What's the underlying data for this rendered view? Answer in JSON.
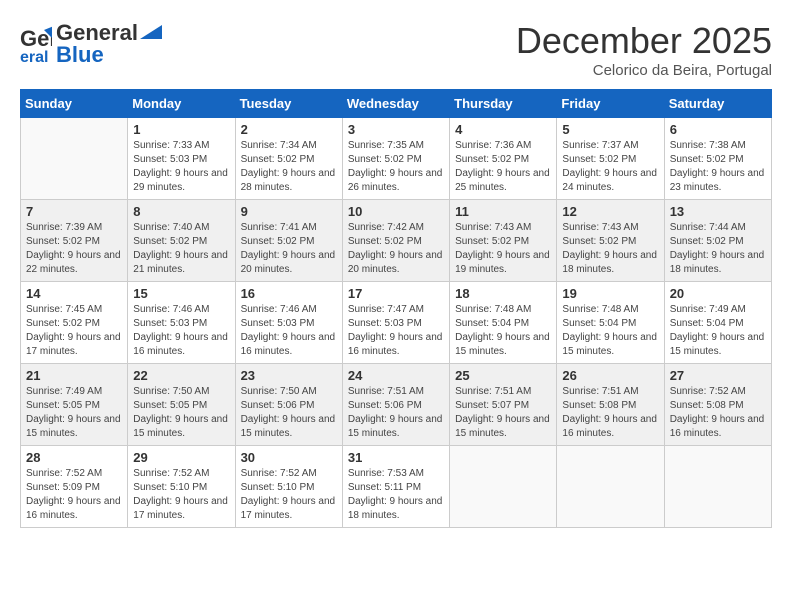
{
  "header": {
    "logo_general": "General",
    "logo_blue": "Blue",
    "month_title": "December 2025",
    "location": "Celorico da Beira, Portugal"
  },
  "weekdays": [
    "Sunday",
    "Monday",
    "Tuesday",
    "Wednesday",
    "Thursday",
    "Friday",
    "Saturday"
  ],
  "weeks": [
    [
      {
        "day": "",
        "sunrise": "",
        "sunset": "",
        "daylight": ""
      },
      {
        "day": "1",
        "sunrise": "Sunrise: 7:33 AM",
        "sunset": "Sunset: 5:03 PM",
        "daylight": "Daylight: 9 hours and 29 minutes."
      },
      {
        "day": "2",
        "sunrise": "Sunrise: 7:34 AM",
        "sunset": "Sunset: 5:02 PM",
        "daylight": "Daylight: 9 hours and 28 minutes."
      },
      {
        "day": "3",
        "sunrise": "Sunrise: 7:35 AM",
        "sunset": "Sunset: 5:02 PM",
        "daylight": "Daylight: 9 hours and 26 minutes."
      },
      {
        "day": "4",
        "sunrise": "Sunrise: 7:36 AM",
        "sunset": "Sunset: 5:02 PM",
        "daylight": "Daylight: 9 hours and 25 minutes."
      },
      {
        "day": "5",
        "sunrise": "Sunrise: 7:37 AM",
        "sunset": "Sunset: 5:02 PM",
        "daylight": "Daylight: 9 hours and 24 minutes."
      },
      {
        "day": "6",
        "sunrise": "Sunrise: 7:38 AM",
        "sunset": "Sunset: 5:02 PM",
        "daylight": "Daylight: 9 hours and 23 minutes."
      }
    ],
    [
      {
        "day": "7",
        "sunrise": "Sunrise: 7:39 AM",
        "sunset": "Sunset: 5:02 PM",
        "daylight": "Daylight: 9 hours and 22 minutes."
      },
      {
        "day": "8",
        "sunrise": "Sunrise: 7:40 AM",
        "sunset": "Sunset: 5:02 PM",
        "daylight": "Daylight: 9 hours and 21 minutes."
      },
      {
        "day": "9",
        "sunrise": "Sunrise: 7:41 AM",
        "sunset": "Sunset: 5:02 PM",
        "daylight": "Daylight: 9 hours and 20 minutes."
      },
      {
        "day": "10",
        "sunrise": "Sunrise: 7:42 AM",
        "sunset": "Sunset: 5:02 PM",
        "daylight": "Daylight: 9 hours and 20 minutes."
      },
      {
        "day": "11",
        "sunrise": "Sunrise: 7:43 AM",
        "sunset": "Sunset: 5:02 PM",
        "daylight": "Daylight: 9 hours and 19 minutes."
      },
      {
        "day": "12",
        "sunrise": "Sunrise: 7:43 AM",
        "sunset": "Sunset: 5:02 PM",
        "daylight": "Daylight: 9 hours and 18 minutes."
      },
      {
        "day": "13",
        "sunrise": "Sunrise: 7:44 AM",
        "sunset": "Sunset: 5:02 PM",
        "daylight": "Daylight: 9 hours and 18 minutes."
      }
    ],
    [
      {
        "day": "14",
        "sunrise": "Sunrise: 7:45 AM",
        "sunset": "Sunset: 5:02 PM",
        "daylight": "Daylight: 9 hours and 17 minutes."
      },
      {
        "day": "15",
        "sunrise": "Sunrise: 7:46 AM",
        "sunset": "Sunset: 5:03 PM",
        "daylight": "Daylight: 9 hours and 16 minutes."
      },
      {
        "day": "16",
        "sunrise": "Sunrise: 7:46 AM",
        "sunset": "Sunset: 5:03 PM",
        "daylight": "Daylight: 9 hours and 16 minutes."
      },
      {
        "day": "17",
        "sunrise": "Sunrise: 7:47 AM",
        "sunset": "Sunset: 5:03 PM",
        "daylight": "Daylight: 9 hours and 16 minutes."
      },
      {
        "day": "18",
        "sunrise": "Sunrise: 7:48 AM",
        "sunset": "Sunset: 5:04 PM",
        "daylight": "Daylight: 9 hours and 15 minutes."
      },
      {
        "day": "19",
        "sunrise": "Sunrise: 7:48 AM",
        "sunset": "Sunset: 5:04 PM",
        "daylight": "Daylight: 9 hours and 15 minutes."
      },
      {
        "day": "20",
        "sunrise": "Sunrise: 7:49 AM",
        "sunset": "Sunset: 5:04 PM",
        "daylight": "Daylight: 9 hours and 15 minutes."
      }
    ],
    [
      {
        "day": "21",
        "sunrise": "Sunrise: 7:49 AM",
        "sunset": "Sunset: 5:05 PM",
        "daylight": "Daylight: 9 hours and 15 minutes."
      },
      {
        "day": "22",
        "sunrise": "Sunrise: 7:50 AM",
        "sunset": "Sunset: 5:05 PM",
        "daylight": "Daylight: 9 hours and 15 minutes."
      },
      {
        "day": "23",
        "sunrise": "Sunrise: 7:50 AM",
        "sunset": "Sunset: 5:06 PM",
        "daylight": "Daylight: 9 hours and 15 minutes."
      },
      {
        "day": "24",
        "sunrise": "Sunrise: 7:51 AM",
        "sunset": "Sunset: 5:06 PM",
        "daylight": "Daylight: 9 hours and 15 minutes."
      },
      {
        "day": "25",
        "sunrise": "Sunrise: 7:51 AM",
        "sunset": "Sunset: 5:07 PM",
        "daylight": "Daylight: 9 hours and 15 minutes."
      },
      {
        "day": "26",
        "sunrise": "Sunrise: 7:51 AM",
        "sunset": "Sunset: 5:08 PM",
        "daylight": "Daylight: 9 hours and 16 minutes."
      },
      {
        "day": "27",
        "sunrise": "Sunrise: 7:52 AM",
        "sunset": "Sunset: 5:08 PM",
        "daylight": "Daylight: 9 hours and 16 minutes."
      }
    ],
    [
      {
        "day": "28",
        "sunrise": "Sunrise: 7:52 AM",
        "sunset": "Sunset: 5:09 PM",
        "daylight": "Daylight: 9 hours and 16 minutes."
      },
      {
        "day": "29",
        "sunrise": "Sunrise: 7:52 AM",
        "sunset": "Sunset: 5:10 PM",
        "daylight": "Daylight: 9 hours and 17 minutes."
      },
      {
        "day": "30",
        "sunrise": "Sunrise: 7:52 AM",
        "sunset": "Sunset: 5:10 PM",
        "daylight": "Daylight: 9 hours and 17 minutes."
      },
      {
        "day": "31",
        "sunrise": "Sunrise: 7:53 AM",
        "sunset": "Sunset: 5:11 PM",
        "daylight": "Daylight: 9 hours and 18 minutes."
      },
      {
        "day": "",
        "sunrise": "",
        "sunset": "",
        "daylight": ""
      },
      {
        "day": "",
        "sunrise": "",
        "sunset": "",
        "daylight": ""
      },
      {
        "day": "",
        "sunrise": "",
        "sunset": "",
        "daylight": ""
      }
    ]
  ]
}
